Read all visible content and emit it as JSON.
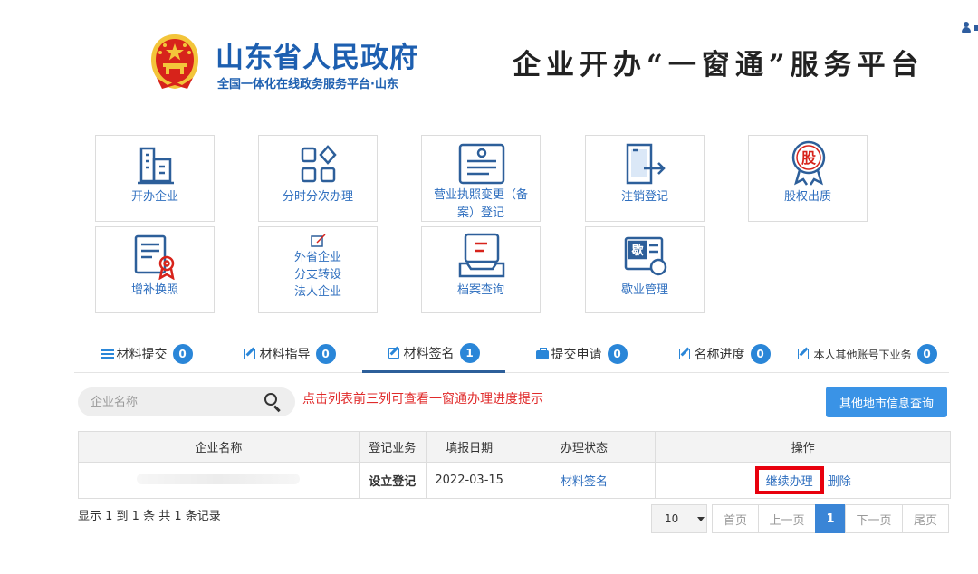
{
  "header": {
    "gov_title": "山东省人民政府",
    "gov_subtitle": "全国一体化在线政务服务平台·山东",
    "platform_title": "企业开办“一窗通”服务平台",
    "colors": {
      "brand_blue": "#1d5fb0",
      "emblem_red": "#d7231b",
      "emblem_gold": "#f3c53a"
    }
  },
  "tiles": [
    {
      "label": "开办企业",
      "icon": "office-building-icon"
    },
    {
      "label": "分时分次办理",
      "icon": "app-grid-icon"
    },
    {
      "label": "营业执照变更（备案）登记",
      "icon": "license-card-icon"
    },
    {
      "label": "注销登记",
      "icon": "exit-door-icon"
    },
    {
      "label": "股权出质",
      "icon": "equity-stamp-icon"
    },
    {
      "label": "增补换照",
      "icon": "certificate-icon"
    },
    {
      "label": "外省企业\n分支转设\n法人企业",
      "icon": "edit-note-icon"
    },
    {
      "label": "档案查询",
      "icon": "archive-box-icon"
    },
    {
      "label": "歇业管理",
      "icon": "suspension-card-icon"
    }
  ],
  "tabs": [
    {
      "label": "材料提交",
      "count": "0",
      "icon": "list-icon"
    },
    {
      "label": "材料指导",
      "count": "0",
      "icon": "edit-icon"
    },
    {
      "label": "材料签名",
      "count": "1",
      "icon": "edit-icon",
      "active": true
    },
    {
      "label": "提交申请",
      "count": "0",
      "icon": "briefcase-icon"
    },
    {
      "label": "名称进度",
      "count": "0",
      "icon": "edit-icon"
    },
    {
      "label": "本人其他账号下业务",
      "count": "0",
      "icon": "edit-icon"
    }
  ],
  "search": {
    "placeholder": "企业名称",
    "value": ""
  },
  "hint": "点击列表前三列可查看一窗通办理进度提示",
  "other_city_button": "其他地市信息查询",
  "table": {
    "columns": [
      "企业名称",
      "登记业务",
      "填报日期",
      "办理状态",
      "操作"
    ],
    "rows": [
      {
        "company": "",
        "business": "设立登记",
        "date": "2022-03-15",
        "status": "材料签名",
        "continue": "继续办理",
        "delete": "删除"
      }
    ]
  },
  "summary": "显示 1 到 1 条 共 1 条记录",
  "pagination": {
    "page_size": "10",
    "first": "首页",
    "prev": "上一页",
    "current": "1",
    "next": "下一页",
    "last": "尾页"
  }
}
